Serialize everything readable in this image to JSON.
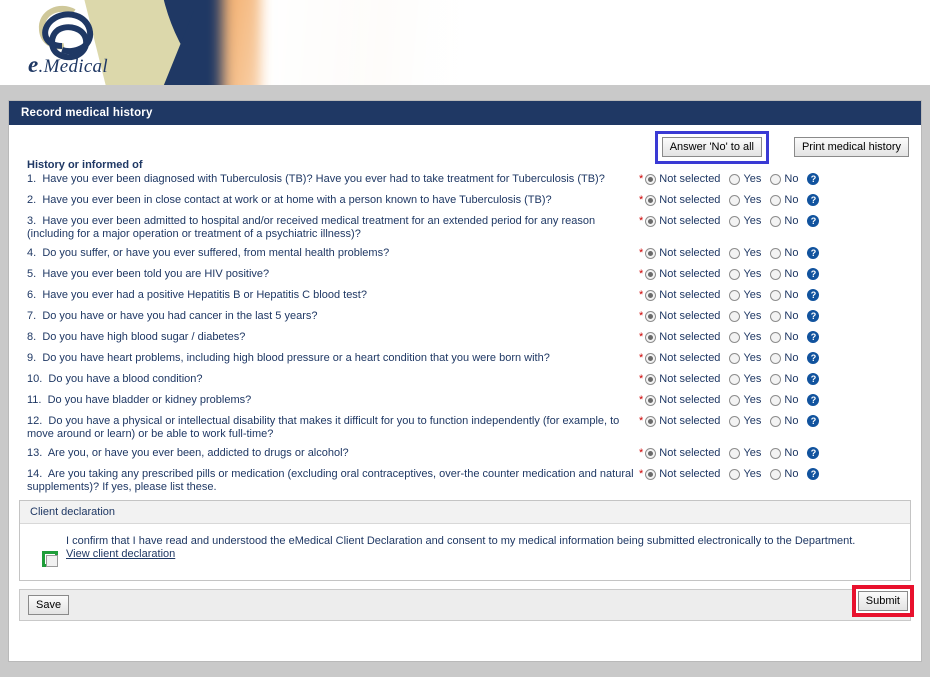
{
  "banner": {
    "logo_text": "Medical",
    "logo_mark": "e"
  },
  "panel": {
    "title": "Record medical history"
  },
  "toolbar": {
    "answer_no_label": "Answer 'No' to all",
    "print_label": "Print medical history",
    "answer_no_highlight_color": "#3a3ad4"
  },
  "questions": {
    "heading": "History or informed of",
    "required_marker": "*",
    "help_icon": "help-icon",
    "options": {
      "not_selected": "Not selected",
      "yes": "Yes",
      "no": "No"
    },
    "selected_value": "Not selected",
    "items": [
      {
        "num": "1.",
        "text": "Have you ever been diagnosed with Tuberculosis (TB)? Have you ever had to take treatment for Tuberculosis (TB)?"
      },
      {
        "num": "2.",
        "text": "Have you ever been in close contact at work or at home with a person known to have Tuberculosis (TB)?"
      },
      {
        "num": "3.",
        "text": "Have you ever been admitted to hospital and/or received medical treatment for an extended period for any reason (including for a major operation or treatment of a psychiatric illness)?"
      },
      {
        "num": "4.",
        "text": "Do you suffer, or have you ever suffered, from mental health problems?"
      },
      {
        "num": "5.",
        "text": "Have you ever been told you are HIV positive?"
      },
      {
        "num": "6.",
        "text": "Have you ever had a positive Hepatitis B or Hepatitis C blood test?"
      },
      {
        "num": "7.",
        "text": "Do you have or have you had cancer in the last 5 years?"
      },
      {
        "num": "8.",
        "text": "Do you have high blood sugar / diabetes?"
      },
      {
        "num": "9.",
        "text": "Do you have heart problems, including high blood pressure or a heart condition that you were born with?"
      },
      {
        "num": "10.",
        "text": "Do you have a blood condition?"
      },
      {
        "num": "11.",
        "text": "Do you have bladder or kidney problems?"
      },
      {
        "num": "12.",
        "text": "Do you have a physical or intellectual disability that makes it difficult for you to function independently (for example, to move around or learn) or be able to work full-time?"
      },
      {
        "num": "13.",
        "text": "Are you, or have you ever been, addicted to drugs or alcohol?"
      },
      {
        "num": "14.",
        "text": "Are you taking any prescribed pills or medication (excluding oral contraceptives, over-the counter medication and natural supplements)? If yes, please list these."
      }
    ]
  },
  "declaration": {
    "header": "Client declaration",
    "consent_text": "I confirm that I have read and understood the eMedical Client Declaration and consent to my medical information being submitted electronically to the Department.",
    "link_label": "View client declaration",
    "checkbox_checked": false,
    "checkbox_highlight_color": "#1f9d3a"
  },
  "footer": {
    "save_label": "Save",
    "submit_label": "Submit",
    "submit_highlight_color": "#e8112d"
  }
}
